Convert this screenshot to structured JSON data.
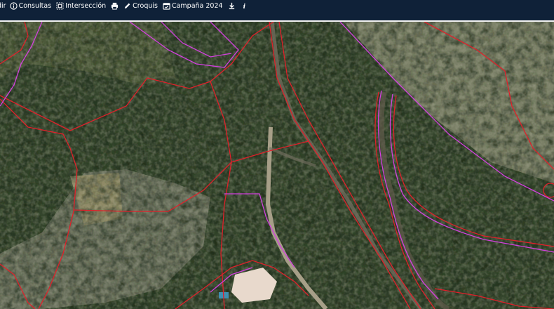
{
  "toolbar": {
    "items": [
      {
        "label": "dir",
        "icon": "add-icon"
      },
      {
        "label": "Consultas",
        "icon": "info-circle-icon"
      },
      {
        "label": "Intersección",
        "icon": "intersect-icon"
      },
      {
        "label": "",
        "icon": "printer-icon"
      },
      {
        "label": "Croquis",
        "icon": "pencil-icon"
      },
      {
        "label": "Campaña 2024",
        "icon": "calendar-check-icon"
      },
      {
        "label": "",
        "icon": "download-icon"
      },
      {
        "label": "",
        "icon": "info-icon"
      }
    ]
  },
  "map": {
    "type": "aerial orthophoto",
    "parcel_line_color": "#e0202a",
    "enclosure_line_color": "#d43fe0"
  }
}
